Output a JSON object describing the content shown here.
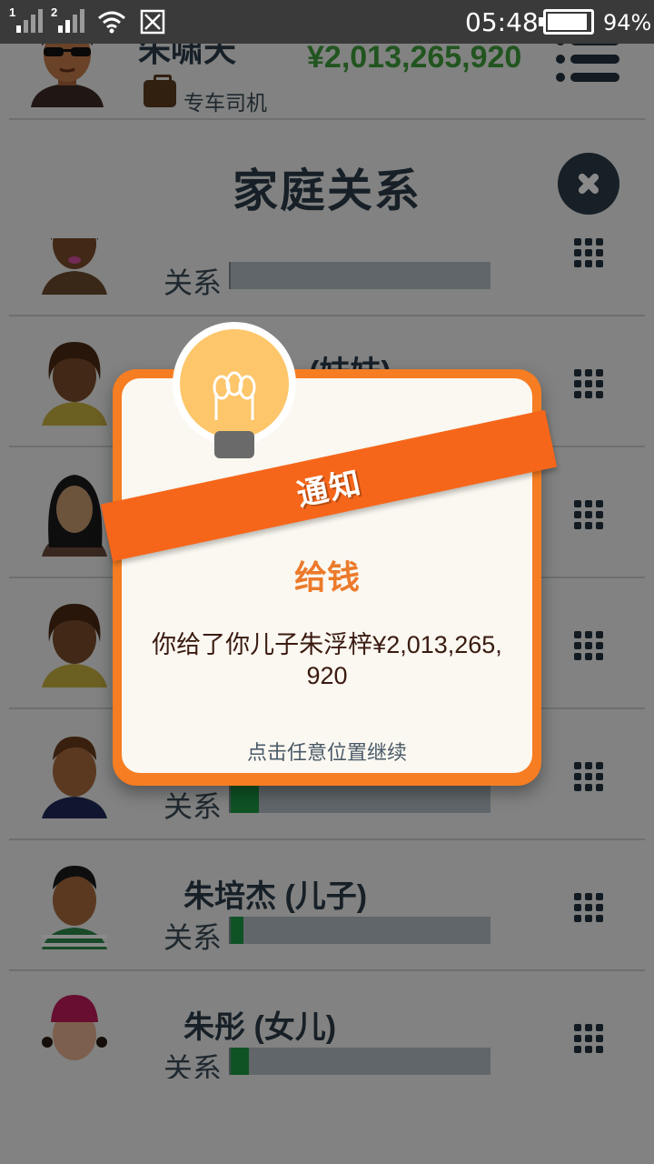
{
  "status_bar": {
    "sim1": "1",
    "sim2": "2",
    "time": "05:48",
    "battery_pct": "94%",
    "battery_level": 0.94
  },
  "header": {
    "player_name": "朱啸天",
    "money": "¥2,013,265,920",
    "job": "专车司机",
    "avatar_icon": "sunglasses-man-avatar-icon",
    "job_icon": "briefcase-icon",
    "menu_icon": "list-menu-icon"
  },
  "section": {
    "title": "家庭关系",
    "close_icon": "close-icon"
  },
  "members": [
    {
      "name": "",
      "relation_label": "关系",
      "relationship_level": 0.0,
      "avatar_icon": "woman-avatar-icon"
    },
    {
      "name": "(妹妹)",
      "relation_label": "",
      "relationship_level": 0.0,
      "avatar_icon": "woman-avatar-icon"
    },
    {
      "name": "",
      "relation_label": "",
      "relationship_level": 0.0,
      "avatar_icon": "woman-long-hair-avatar-icon"
    },
    {
      "name": "",
      "relation_label": "",
      "relationship_level": 0.0,
      "avatar_icon": "woman-avatar-icon"
    },
    {
      "name": "",
      "relation_label": "关系",
      "relationship_level": 0.11,
      "avatar_icon": "boy-avatar-icon"
    },
    {
      "name": "朱培杰 (儿子)",
      "relation_label": "关系",
      "relationship_level": 0.05,
      "avatar_icon": "boy-striped-shirt-avatar-icon"
    },
    {
      "name": "朱彤 (女儿)",
      "relation_label": "关系",
      "relationship_level": 0.07,
      "avatar_icon": "girl-hat-avatar-icon"
    }
  ],
  "notification": {
    "ribbon_label": "通知",
    "title": "给钱",
    "message": "你给了你儿子朱浮梓¥2,013,265,920",
    "hint": "点击任意位置继续",
    "icon": "lightbulb-icon"
  },
  "colors": {
    "money_green": "#3e9e3a",
    "accent_orange": "#f6661a",
    "relationship_fill": "#1d9a45",
    "dark_navy": "#2b3a48"
  }
}
